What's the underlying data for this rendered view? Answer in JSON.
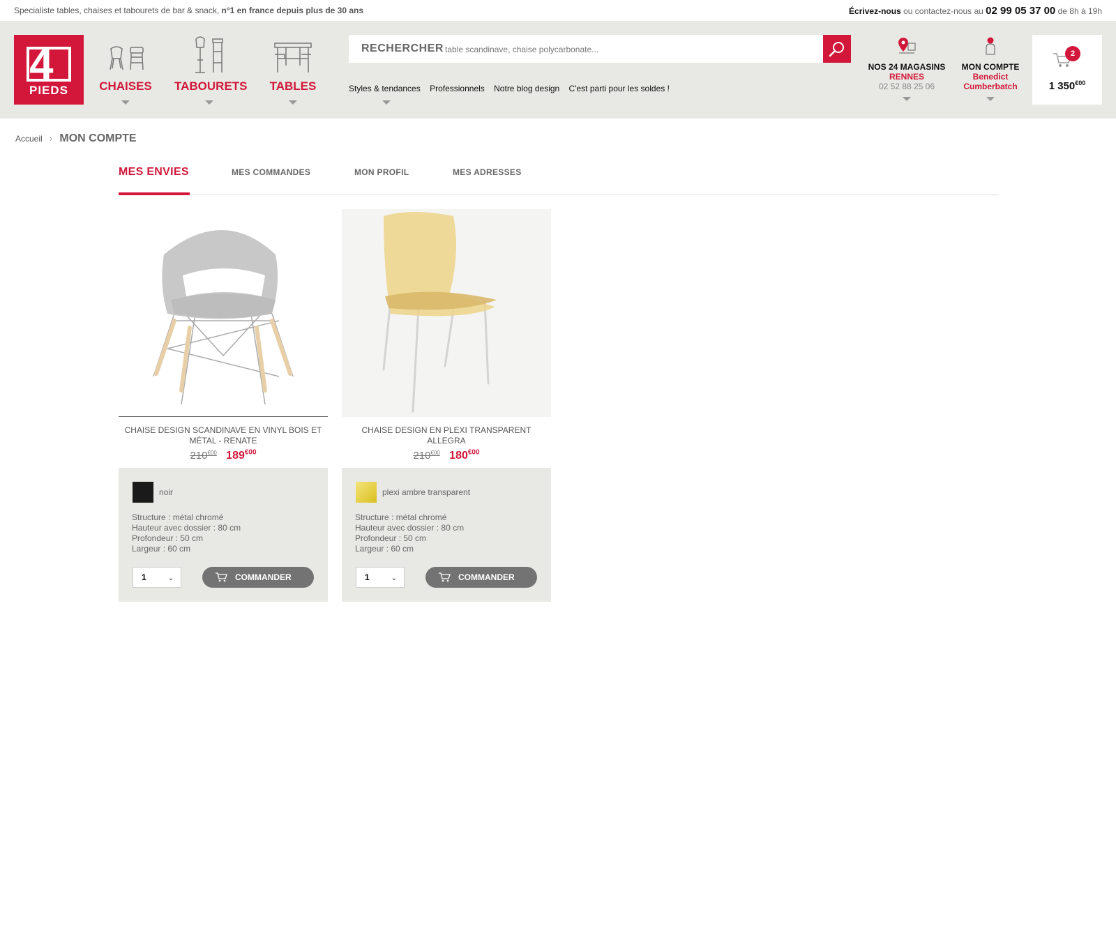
{
  "topbar": {
    "tagline_start": "Specialiste tables, chaises et tabourets de bar & snack, ",
    "tagline_bold": "n°1 en france depuis plus de 30 ans",
    "write_us": "Écrivez-nous",
    "contact_text": " ou contactez-nous au ",
    "phone": "02 99 05 37 00",
    "hours": " de 8h à  19h"
  },
  "logo": {
    "number": "4",
    "text": "PIEDS"
  },
  "categories": [
    {
      "label": "CHAISES",
      "icon": "chairs-icon"
    },
    {
      "label": "TABOURETS",
      "icon": "stools-icon"
    },
    {
      "label": "TABLES",
      "icon": "tables-icon"
    }
  ],
  "search": {
    "label": "RECHERCHER",
    "placeholder": "table scandinave, chaise polycarbonate..."
  },
  "menu": {
    "items": [
      "Styles & tendances",
      "Professionnels",
      "Notre blog design",
      "C'est parti pour les soldes !"
    ]
  },
  "stores": {
    "title": "NOS 24 MAGASINS",
    "city": "RENNES",
    "phone": "02 52 88 25 06"
  },
  "account": {
    "title": "MON COMPTE",
    "first_name": "Benedict",
    "last_name": "Cumberbatch"
  },
  "cart": {
    "count": "2",
    "total": "1 350",
    "cents": "€00"
  },
  "breadcrumb": {
    "home": "Accueil",
    "current": "MON COMPTE"
  },
  "tabs": [
    "MES ENVIES",
    "MES COMMANDES",
    "MON PROFIL",
    "MES ADRESSES"
  ],
  "products": [
    {
      "name": "CHAISE DESIGN SCANDINAVE EN VINYL BOIS ET MÉTAL - RENATE",
      "old_price": "210",
      "old_cents": "€00",
      "price": "189",
      "cents": "€00",
      "color_name": "noir",
      "color_hex": "#1a1a1a",
      "specs": [
        "Structure : métal chromé",
        "Hauteur avec dossier : 80 cm",
        "Profondeur : 50 cm",
        "Largeur : 60 cm"
      ],
      "qty": "1",
      "button": "COMMANDER"
    },
    {
      "name": "CHAISE DESIGN EN PLEXI TRANSPARENT ALLEGRA",
      "old_price": "210",
      "old_cents": "€00",
      "price": "180",
      "cents": "€00",
      "color_name": "plexi ambre transparent",
      "color_hex": "#e8d238",
      "specs": [
        "Structure : métal chromé",
        "Hauteur avec dossier : 80 cm",
        "Profondeur : 50 cm",
        "Largeur : 60 cm"
      ],
      "qty": "1",
      "button": "COMMANDER"
    }
  ],
  "colors": {
    "brand": "#d2173a",
    "header_bg": "#e8e9e4",
    "button_grey": "#737373"
  }
}
